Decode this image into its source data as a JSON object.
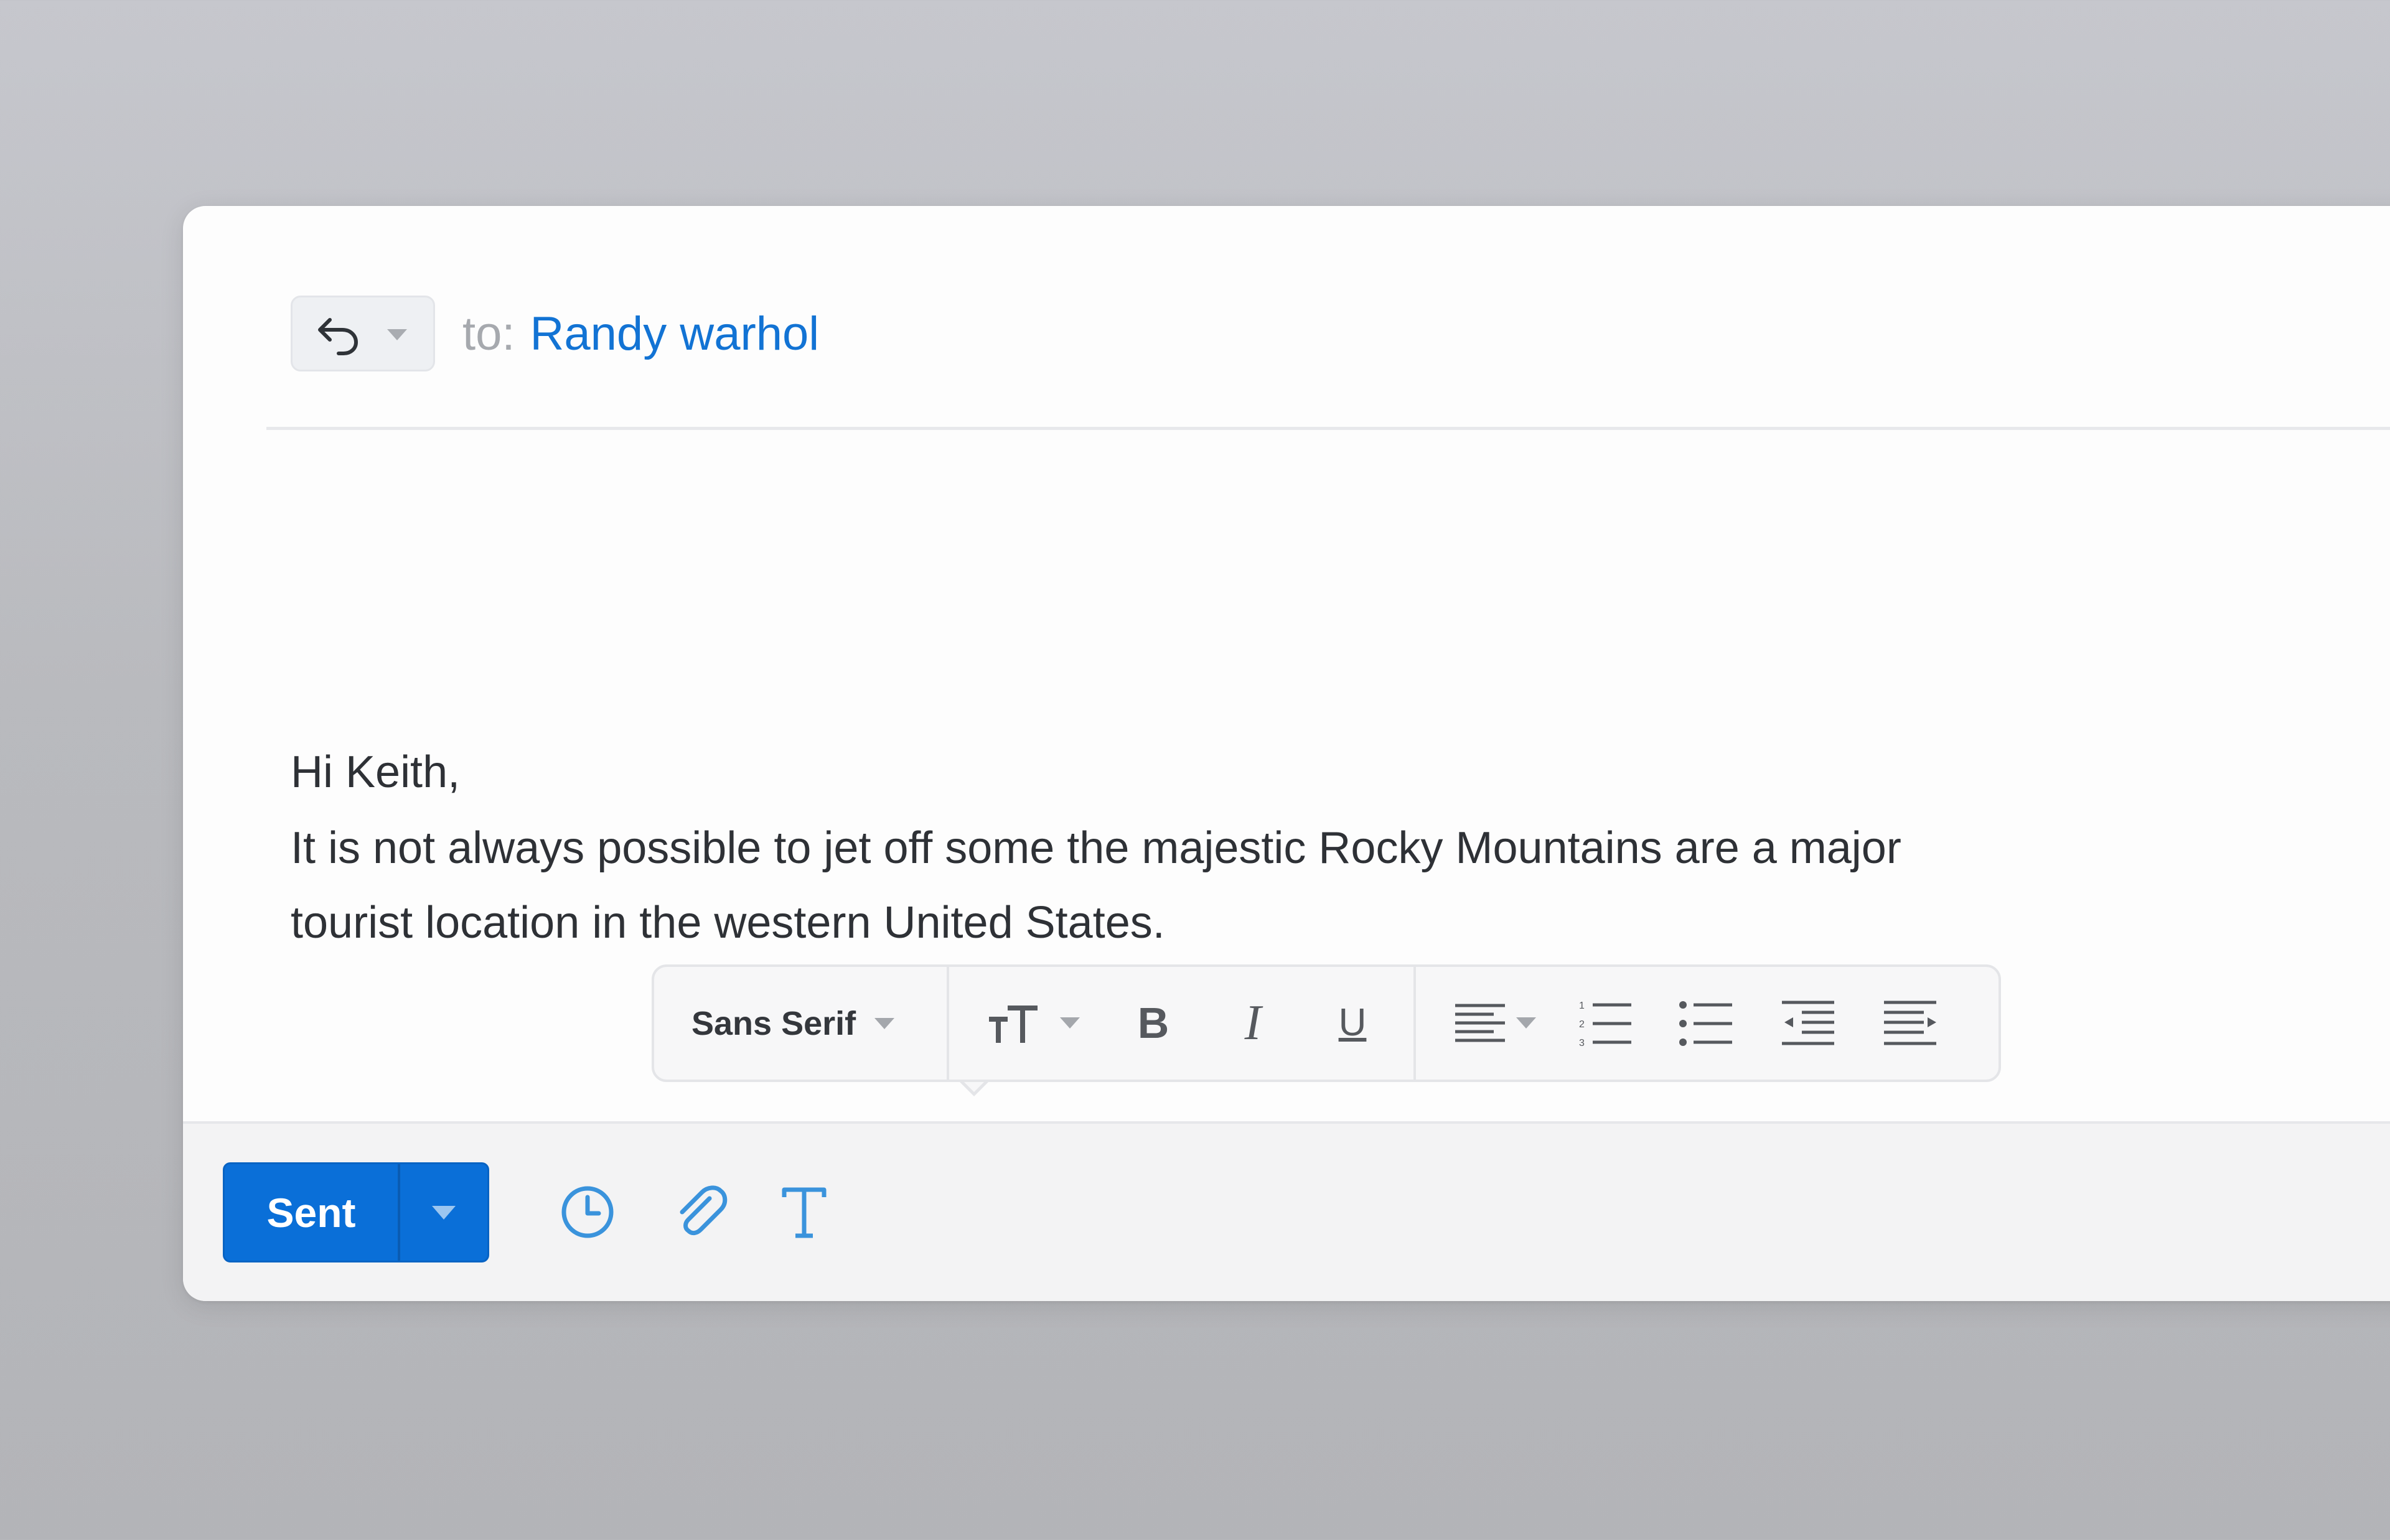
{
  "header": {
    "reply_icon": "reply-icon",
    "to_label": "to:",
    "recipient": "Randy warhol"
  },
  "message": {
    "greeting": "Hi Keith,",
    "paragraph": "It is not always possible to jet off some the majestic Rocky Mountains are a major tourist location in the western United States."
  },
  "format_toolbar": {
    "font_family": "Sans Serif",
    "font_size_icon": "text-size-icon",
    "bold_label": "B",
    "italic_label": "I",
    "underline_label": "U",
    "align_icon": "align-left-icon",
    "numbered_list_icon": "numbered-list-icon",
    "bullet_list_icon": "bullet-list-icon",
    "indent_less_icon": "indent-less-icon",
    "indent_more_icon": "indent-more-icon"
  },
  "footer": {
    "send_label": "Sent",
    "schedule_icon": "clock-icon",
    "attach_icon": "paperclip-icon",
    "format_icon": "text-format-icon"
  },
  "colors": {
    "accent": "#0a6fd8",
    "link": "#1273d4",
    "icon_blue": "#3a93dc",
    "text": "#2e3136",
    "muted": "#a6a9ae"
  }
}
